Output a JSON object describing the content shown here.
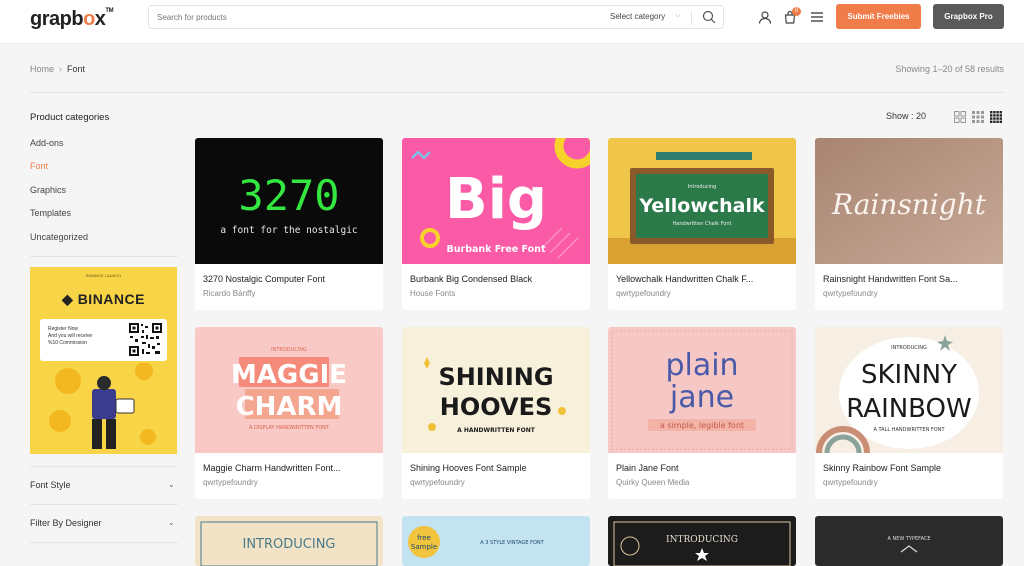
{
  "header": {
    "logo": "grapbox",
    "search_placeholder": "Search for products",
    "category_label": "Select category",
    "cart_count": "0",
    "submit_label": "Submit Freebies",
    "pro_label": "Grapbox Pro"
  },
  "breadcrumb": {
    "home": "Home",
    "current": "Font"
  },
  "results_text": "Showing 1–20 of 58 results",
  "toolbar": {
    "show_label": "Show :",
    "show_value": "20"
  },
  "sidebar": {
    "title": "Product categories",
    "items": [
      {
        "label": "Add-ons",
        "active": false
      },
      {
        "label": "Font",
        "active": true
      },
      {
        "label": "Graphics",
        "active": false
      },
      {
        "label": "Templates",
        "active": false
      },
      {
        "label": "Uncategorized",
        "active": false
      }
    ],
    "ad": {
      "small": "BINANCE LAUNCH",
      "brand": "BINANCE",
      "line1": "Register Now",
      "line2": "And you will receive",
      "line3": "%10 Commission"
    },
    "filters": [
      "Font Style",
      "Filter By Designer"
    ]
  },
  "products": [
    {
      "name": "3270 Nostalgic Computer Font",
      "author": "Ricardo Bánffy",
      "art_title": "3270",
      "art_sub": "a font for the nostalgic"
    },
    {
      "name": "Burbank Big Condensed Black",
      "author": "House Fonts",
      "art_title": "Big",
      "art_sub": "Burbank Free Font"
    },
    {
      "name": "Yellowchalk Handwritten Chalk F...",
      "author": "qwrtypefoundry",
      "art_title": "Yellowchalk",
      "art_sub": "Handwritten Chalk Font"
    },
    {
      "name": "Rainsnight Handwritten Font Sa...",
      "author": "qwrtypefoundry",
      "art_title": "Rainsnight",
      "art_sub": ""
    },
    {
      "name": "Maggie Charm Handwritten Font...",
      "author": "qwrtypefoundry",
      "art_title": "MAGGIE CHARM",
      "art_sub": "A DISPLAY HANDWRITTEN FONT"
    },
    {
      "name": "Shining Hooves Font Sample",
      "author": "qwrtypefoundry",
      "art_title": "SHINING HOOVES",
      "art_sub": "A HANDWRITTEN FONT"
    },
    {
      "name": "Plain Jane Font",
      "author": "Quirky Queen Media",
      "art_title": "plain jane",
      "art_sub": "a simple, legible font"
    },
    {
      "name": "Skinny Rainbow Font Sample",
      "author": "qwrtypefoundry",
      "art_title": "SKINNY RAINBOW",
      "art_sub": "A TALL HANDWRITTEN FONT"
    }
  ],
  "partial_row": [
    {
      "art_title": "INTRODUCING"
    },
    {
      "art_title": "free Sample",
      "art_sub": "A 3 STYLE VINTAGE FONT"
    },
    {
      "art_title": "INTRODUCING"
    },
    {
      "art_title": "A NEW TYPEFACE"
    }
  ],
  "colors": {
    "accent": "#f07c4a",
    "pro": "#5a5a5a"
  }
}
